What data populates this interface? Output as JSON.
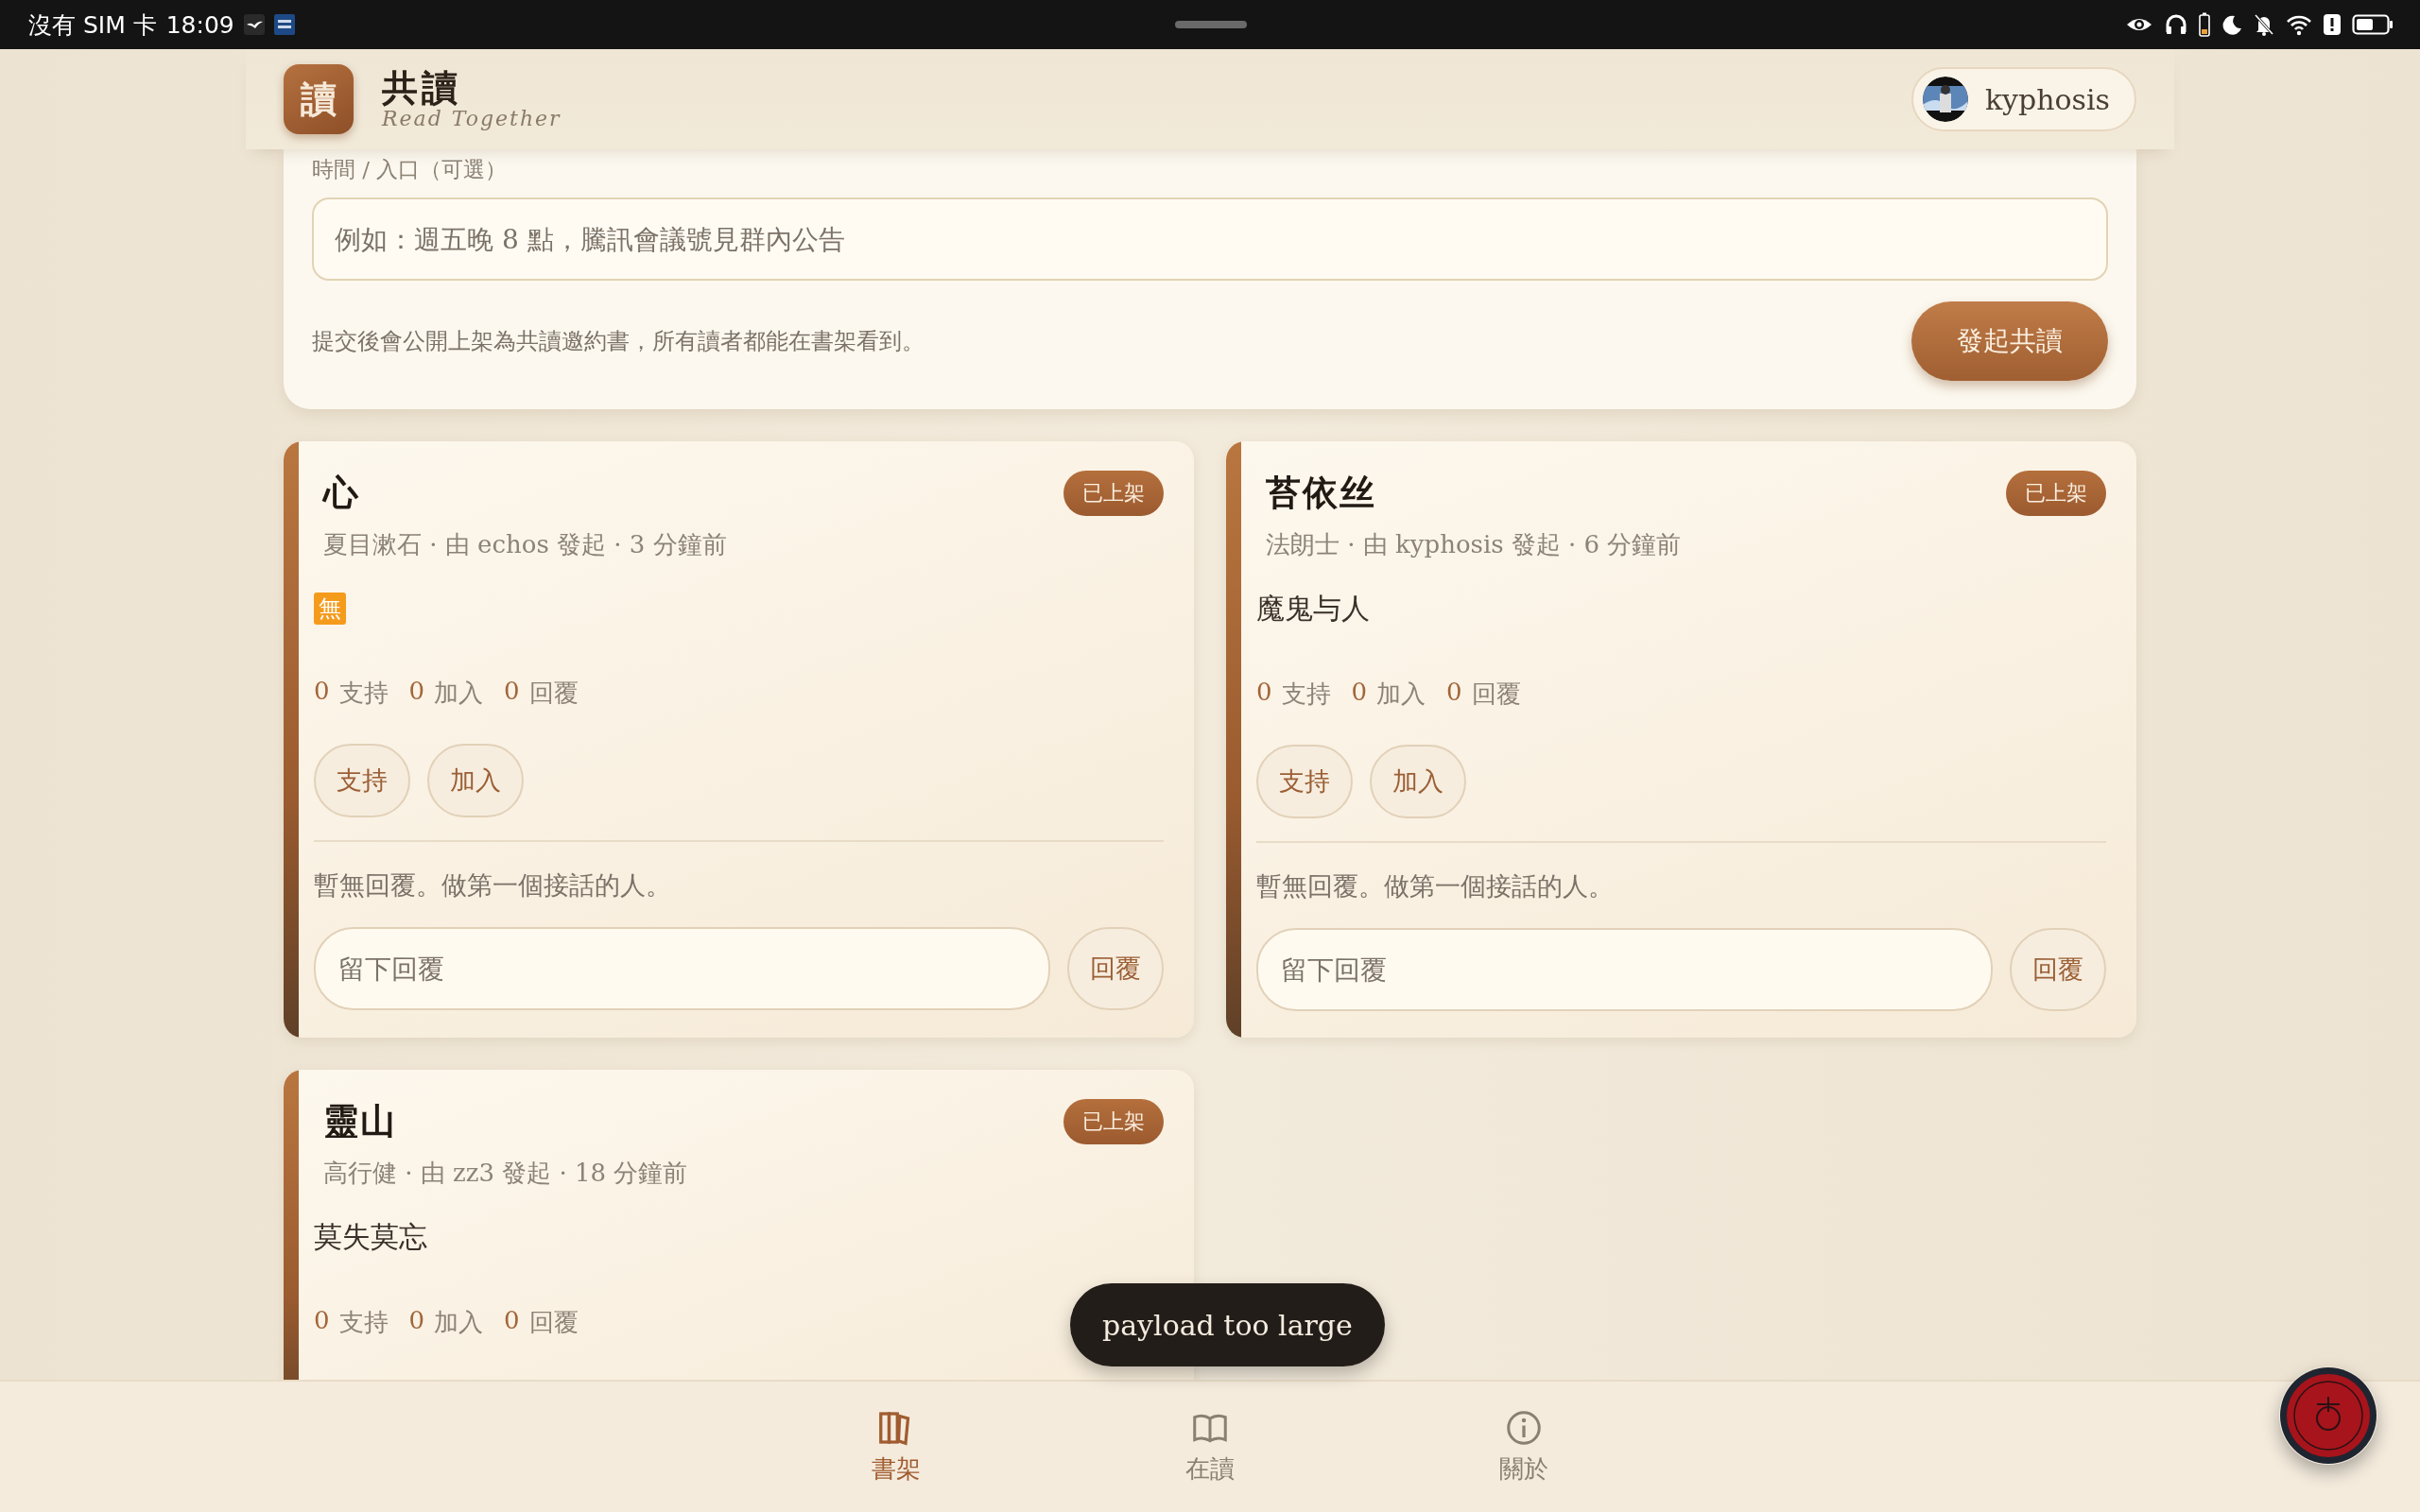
{
  "status_bar": {
    "carrier": "沒有 SIM 卡",
    "time": "18:09"
  },
  "header": {
    "logo": "讀",
    "title": "共讀",
    "subtitle": "Read Together",
    "user": {
      "name": "kyphosis"
    }
  },
  "form": {
    "field_label": "時間 / 入口（可選）",
    "field": {
      "placeholder": "例如：週五晚 8 點，騰訊會議號見群內公告"
    },
    "note": "提交後會公開上架為共讀邀約書，所有讀者都能在書架看到。",
    "submit": "發起共讀"
  },
  "cards": [
    {
      "title": "心",
      "badge": "已上架",
      "meta": "夏目漱石 · 由 echos 發起 · 3 分鐘前",
      "body": {
        "kind": "emoji",
        "text": "無"
      },
      "stats": [
        {
          "count": "0",
          "label": "支持"
        },
        {
          "count": "0",
          "label": "加入"
        },
        {
          "count": "0",
          "label": "回覆"
        }
      ],
      "actions": [
        "支持",
        "加入"
      ],
      "empty_note": "暫無回覆。做第一個接話的人。",
      "reply": {
        "placeholder": "留下回覆",
        "button": "回覆"
      }
    },
    {
      "title": "苔依丝",
      "badge": "已上架",
      "meta": "法朗士 · 由 kyphosis 發起 · 6 分鐘前",
      "body": {
        "kind": "text",
        "text": "魔鬼与人"
      },
      "stats": [
        {
          "count": "0",
          "label": "支持"
        },
        {
          "count": "0",
          "label": "加入"
        },
        {
          "count": "0",
          "label": "回覆"
        }
      ],
      "actions": [
        "支持",
        "加入"
      ],
      "empty_note": "暫無回覆。做第一個接話的人。",
      "reply": {
        "placeholder": "留下回覆",
        "button": "回覆"
      }
    },
    {
      "title": "靈山",
      "badge": "已上架",
      "meta": "高行健 · 由 zz3 發起 · 18 分鐘前",
      "body": {
        "kind": "text",
        "text": "莫失莫忘"
      },
      "stats": [
        {
          "count": "0",
          "label": "支持"
        },
        {
          "count": "0",
          "label": "加入"
        },
        {
          "count": "0",
          "label": "回覆"
        }
      ]
    }
  ],
  "toast": "payload too large",
  "nav": [
    {
      "kind": "shelf",
      "label": "書架",
      "selected": true
    },
    {
      "kind": "reading",
      "label": "在讀",
      "selected": false
    },
    {
      "kind": "about",
      "label": "關於",
      "selected": false
    }
  ]
}
